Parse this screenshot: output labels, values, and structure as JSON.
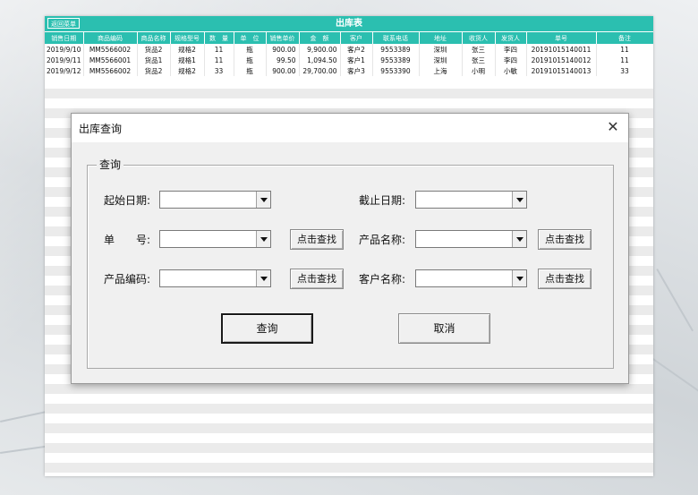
{
  "sheet": {
    "back_label": "返回菜单",
    "title": "出库表",
    "headers": [
      "销售日期",
      "商品编码",
      "商品名称",
      "规格型号",
      "数　量",
      "单　位",
      "销售单价",
      "金　额",
      "客户",
      "联系电话",
      "地址",
      "收货人",
      "发货人",
      "单号",
      "备注"
    ],
    "rows": [
      [
        "2019/9/10",
        "MM5566002",
        "货品2",
        "规格2",
        "11",
        "瓶",
        "900.00",
        "9,900.00",
        "客户2",
        "9553389",
        "深圳",
        "张三",
        "李四",
        "20191015140011",
        "11"
      ],
      [
        "2019/9/11",
        "MM5566001",
        "货品1",
        "规格1",
        "11",
        "瓶",
        "99.50",
        "1,094.50",
        "客户1",
        "9553389",
        "深圳",
        "张三",
        "李四",
        "20191015140012",
        "11"
      ],
      [
        "2019/9/12",
        "MM5566002",
        "货品2",
        "规格2",
        "33",
        "瓶",
        "900.00",
        "29,700.00",
        "客户3",
        "9553390",
        "上海",
        "小明",
        "小敏",
        "20191015140013",
        "33"
      ]
    ],
    "accent": "#2bbfb0"
  },
  "dialog": {
    "title": "出库查询",
    "close_icon": "close-icon",
    "group_label": "查询",
    "start_date_label": "起始日期:",
    "end_date_label": "截止日期:",
    "order_no_label": "单　　号:",
    "product_name_label": "产品名称:",
    "product_code_label": "产品编码:",
    "customer_name_label": "客户名称:",
    "find_label": "点击查找",
    "query_button": "查询",
    "cancel_button": "取消"
  }
}
